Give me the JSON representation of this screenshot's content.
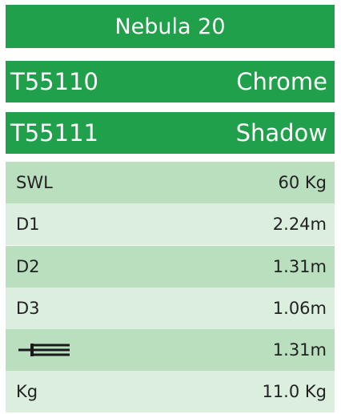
{
  "title": "Nebula 20",
  "variants": [
    {
      "code": "T55110",
      "finish": "Chrome"
    },
    {
      "code": "T55111",
      "finish": "Shadow"
    }
  ],
  "specs": [
    {
      "label": "SWL",
      "value": "60 Kg"
    },
    {
      "label": "D1",
      "value": "2.24m"
    },
    {
      "label": "D2",
      "value": "1.31m"
    },
    {
      "label": "D3",
      "value": "1.06m"
    },
    {
      "icon": "rod-length-icon",
      "value": "1.31m"
    },
    {
      "label": "Kg",
      "value": "11.0 Kg"
    }
  ],
  "colors": {
    "header_green": "#21a04b",
    "row_dark": "#b9dfbe",
    "row_light": "#dcefdf"
  }
}
